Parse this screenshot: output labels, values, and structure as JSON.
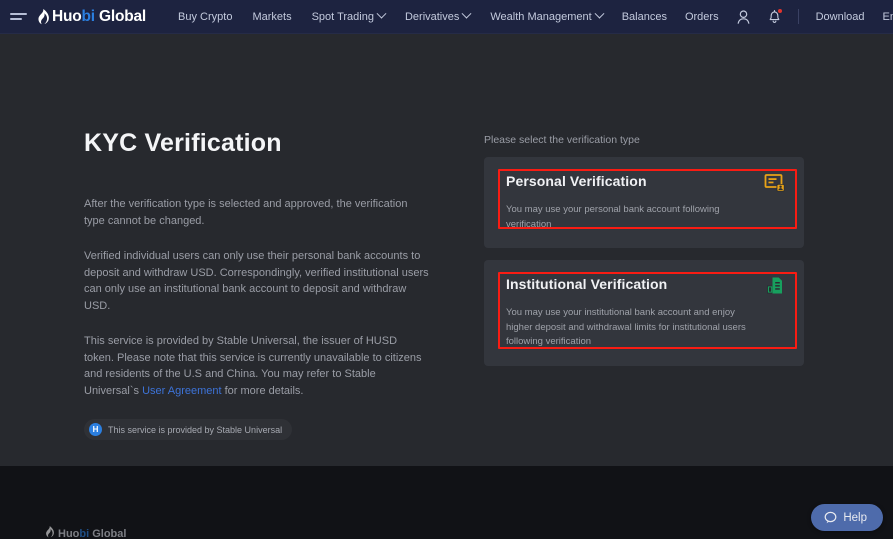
{
  "header": {
    "menu_icon": "hamburger-icon",
    "brand": {
      "prefix": "Huo",
      "accent": "bi",
      "suffix": " Global"
    },
    "nav": [
      {
        "label": "Buy Crypto",
        "caret": false
      },
      {
        "label": "Markets",
        "caret": false
      },
      {
        "label": "Spot Trading",
        "caret": true
      },
      {
        "label": "Derivatives",
        "caret": true
      },
      {
        "label": "Wealth Management",
        "caret": true
      }
    ],
    "right": {
      "balances": "Balances",
      "orders": "Orders",
      "account_icon": "person-icon",
      "notification_icon": "bell-icon",
      "download": "Download",
      "language": "English"
    }
  },
  "main": {
    "title": "KYC Verification",
    "paragraphs": [
      "After the verification type is selected and approved, the verification type cannot be changed.",
      "Verified individual users can only use their personal bank accounts to deposit and withdraw USD. Correspondingly, verified institutional users can only use an institutional bank account to deposit and withdraw USD."
    ],
    "service_note_part1": "This service is provided by Stable Universal, the issuer of HUSD token. Please note that this service is currently unavailable to citizens and residents of the U.S and China. You may refer to Stable Universal`s ",
    "service_note_link": "User Agreement",
    "service_note_part2": " for more details.",
    "badge": {
      "icon_letter": "H",
      "text": "This service is provided by Stable Universal"
    }
  },
  "verification": {
    "select_label": "Please select the verification type",
    "cards": [
      {
        "title": "Personal Verification",
        "desc": "You may use your personal bank account following verification",
        "icon": "id-card-orange-icon",
        "icon_color": "#e8a317"
      },
      {
        "title": "Institutional Verification",
        "desc": "You may use your institutional bank account and enjoy higher deposit and withdrawal limits for institutional users following verification",
        "icon": "building-document-green-icon",
        "icon_color": "#17a05e"
      }
    ],
    "annotation_color": "#f91c13"
  },
  "footer": {
    "brand": {
      "prefix": "Huo",
      "accent": "bi",
      "suffix": " Global"
    },
    "help_button": {
      "label": "Help",
      "icon": "chat-bubble-icon"
    }
  },
  "colors": {
    "header_bg": "#1d2340",
    "content_bg": "#27292e",
    "card_bg": "#33363d",
    "footer_bg": "#111216",
    "accent_blue": "#2b7fe0",
    "link_blue": "#3d73d8",
    "help_blue": "#4e6bab"
  }
}
